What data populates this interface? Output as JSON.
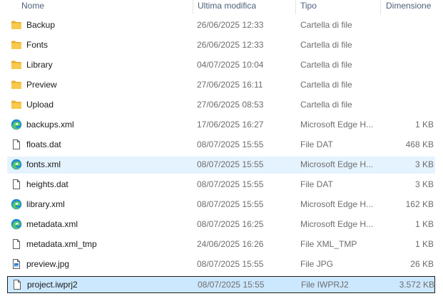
{
  "columns": {
    "name": "Nome",
    "modified": "Ultima modifica",
    "type": "Tipo",
    "size": "Dimensione"
  },
  "files": [
    {
      "name": "Backup",
      "modified": "26/06/2025 12:33",
      "type": "Cartella di file",
      "size": "",
      "icon": "folder-icon"
    },
    {
      "name": "Fonts",
      "modified": "26/06/2025 12:33",
      "type": "Cartella di file",
      "size": "",
      "icon": "folder-icon"
    },
    {
      "name": "Library",
      "modified": "04/07/2025 10:04",
      "type": "Cartella di file",
      "size": "",
      "icon": "folder-icon"
    },
    {
      "name": "Preview",
      "modified": "27/06/2025 16:11",
      "type": "Cartella di file",
      "size": "",
      "icon": "folder-icon"
    },
    {
      "name": "Upload",
      "modified": "27/06/2025 08:53",
      "type": "Cartella di file",
      "size": "",
      "icon": "folder-icon"
    },
    {
      "name": "backups.xml",
      "modified": "17/06/2025 16:27",
      "type": "Microsoft Edge H...",
      "size": "1 KB",
      "icon": "edge-icon"
    },
    {
      "name": "floats.dat",
      "modified": "08/07/2025 15:55",
      "type": "File DAT",
      "size": "468 KB",
      "icon": "file-icon"
    },
    {
      "name": "fonts.xml",
      "modified": "08/07/2025 15:55",
      "type": "Microsoft Edge H...",
      "size": "3 KB",
      "icon": "edge-icon"
    },
    {
      "name": "heights.dat",
      "modified": "08/07/2025 15:55",
      "type": "File DAT",
      "size": "3 KB",
      "icon": "file-icon"
    },
    {
      "name": "library.xml",
      "modified": "08/07/2025 15:55",
      "type": "Microsoft Edge H...",
      "size": "162 KB",
      "icon": "edge-icon"
    },
    {
      "name": "metadata.xml",
      "modified": "08/07/2025 16:25",
      "type": "Microsoft Edge H...",
      "size": "1 KB",
      "icon": "edge-icon"
    },
    {
      "name": "metadata.xml_tmp",
      "modified": "24/06/2025 16:26",
      "type": "File XML_TMP",
      "size": "1 KB",
      "icon": "file-icon"
    },
    {
      "name": "preview.jpg",
      "modified": "08/07/2025 15:55",
      "type": "File JPG",
      "size": "26 KB",
      "icon": "image-file-icon"
    },
    {
      "name": "project.iwprj2",
      "modified": "08/07/2025 15:55",
      "type": "File IWPRJ2",
      "size": "3.572 KB",
      "icon": "file-icon"
    }
  ],
  "hovered_index": 7,
  "selected_index": 13,
  "colors": {
    "hover": "#e5f3ff",
    "selected": "#cce8ff",
    "folder": "#f8c94c",
    "edge": "#1e88d6"
  }
}
